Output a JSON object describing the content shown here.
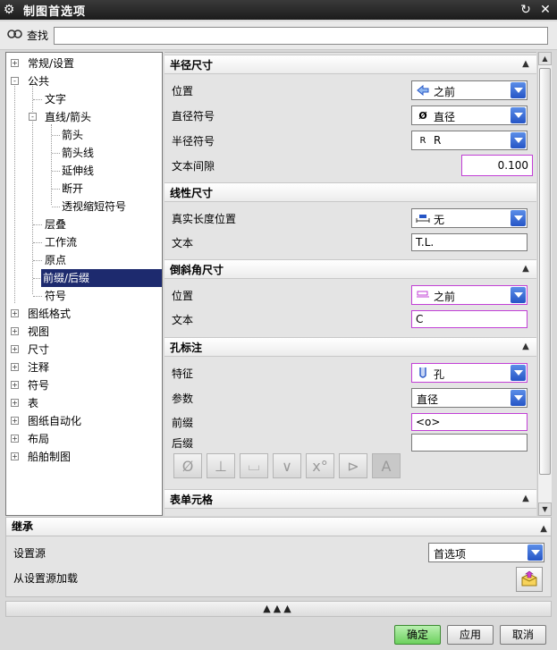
{
  "window": {
    "title": "制图首选项"
  },
  "search": {
    "label": "查找",
    "value": ""
  },
  "tree": [
    {
      "label": "常规/设置",
      "expander": "+"
    },
    {
      "label": "公共",
      "expander": "-"
    },
    {
      "label": "文字",
      "expander": ""
    },
    {
      "label": "直线/箭头",
      "expander": "-"
    },
    {
      "label": "箭头",
      "expander": ""
    },
    {
      "label": "箭头线",
      "expander": ""
    },
    {
      "label": "延伸线",
      "expander": ""
    },
    {
      "label": "断开",
      "expander": ""
    },
    {
      "label": "透视缩短符号",
      "expander": ""
    },
    {
      "label": "层叠",
      "expander": ""
    },
    {
      "label": "工作流",
      "expander": ""
    },
    {
      "label": "原点",
      "expander": ""
    },
    {
      "label": "前缀/后缀",
      "expander": "",
      "selected": true
    },
    {
      "label": "符号",
      "expander": ""
    },
    {
      "label": "图纸格式",
      "expander": "+"
    },
    {
      "label": "视图",
      "expander": "+"
    },
    {
      "label": "尺寸",
      "expander": "+"
    },
    {
      "label": "注释",
      "expander": "+"
    },
    {
      "label": "符号",
      "expander": "+"
    },
    {
      "label": "表",
      "expander": "+"
    },
    {
      "label": "图纸自动化",
      "expander": "+"
    },
    {
      "label": "布局",
      "expander": "+"
    },
    {
      "label": "船舶制图",
      "expander": "+"
    }
  ],
  "radius": {
    "title": "半径尺寸",
    "position_label": "位置",
    "position_value": "之前",
    "diameter_label": "直径符号",
    "diameter_glyph": "Ø",
    "diameter_value": "直径",
    "radius_label": "半径符号",
    "radius_glyph": "R",
    "radius_value": "R",
    "gap_label": "文本间隙",
    "gap_value": "0.100"
  },
  "linear": {
    "title": "线性尺寸",
    "true_length_label": "真实长度位置",
    "true_length_value": "无",
    "text_label": "文本",
    "text_value": "T.L."
  },
  "chamfer": {
    "title": "倒斜角尺寸",
    "position_label": "位置",
    "position_value": "之前",
    "text_label": "文本",
    "text_value": "C"
  },
  "hole": {
    "title": "孔标注",
    "feature_label": "特征",
    "feature_value": "孔",
    "param_label": "参数",
    "param_value": "直径",
    "prefix_label": "前缀",
    "prefix_value": "<o>",
    "suffix_label": "后缀",
    "suffix_value": ""
  },
  "table_cell": {
    "title": "表单元格"
  },
  "inherit": {
    "title": "继承",
    "source_label": "设置源",
    "source_value": "首选项",
    "load_label": "从设置源加载"
  },
  "buttons": {
    "ok": "确定",
    "apply": "应用",
    "cancel": "取消"
  },
  "colors": {
    "accent_blue": "#2555c6",
    "highlight": "#c23fd6",
    "selected": "#1d2a6e",
    "ok_green": "#6cd15e"
  }
}
